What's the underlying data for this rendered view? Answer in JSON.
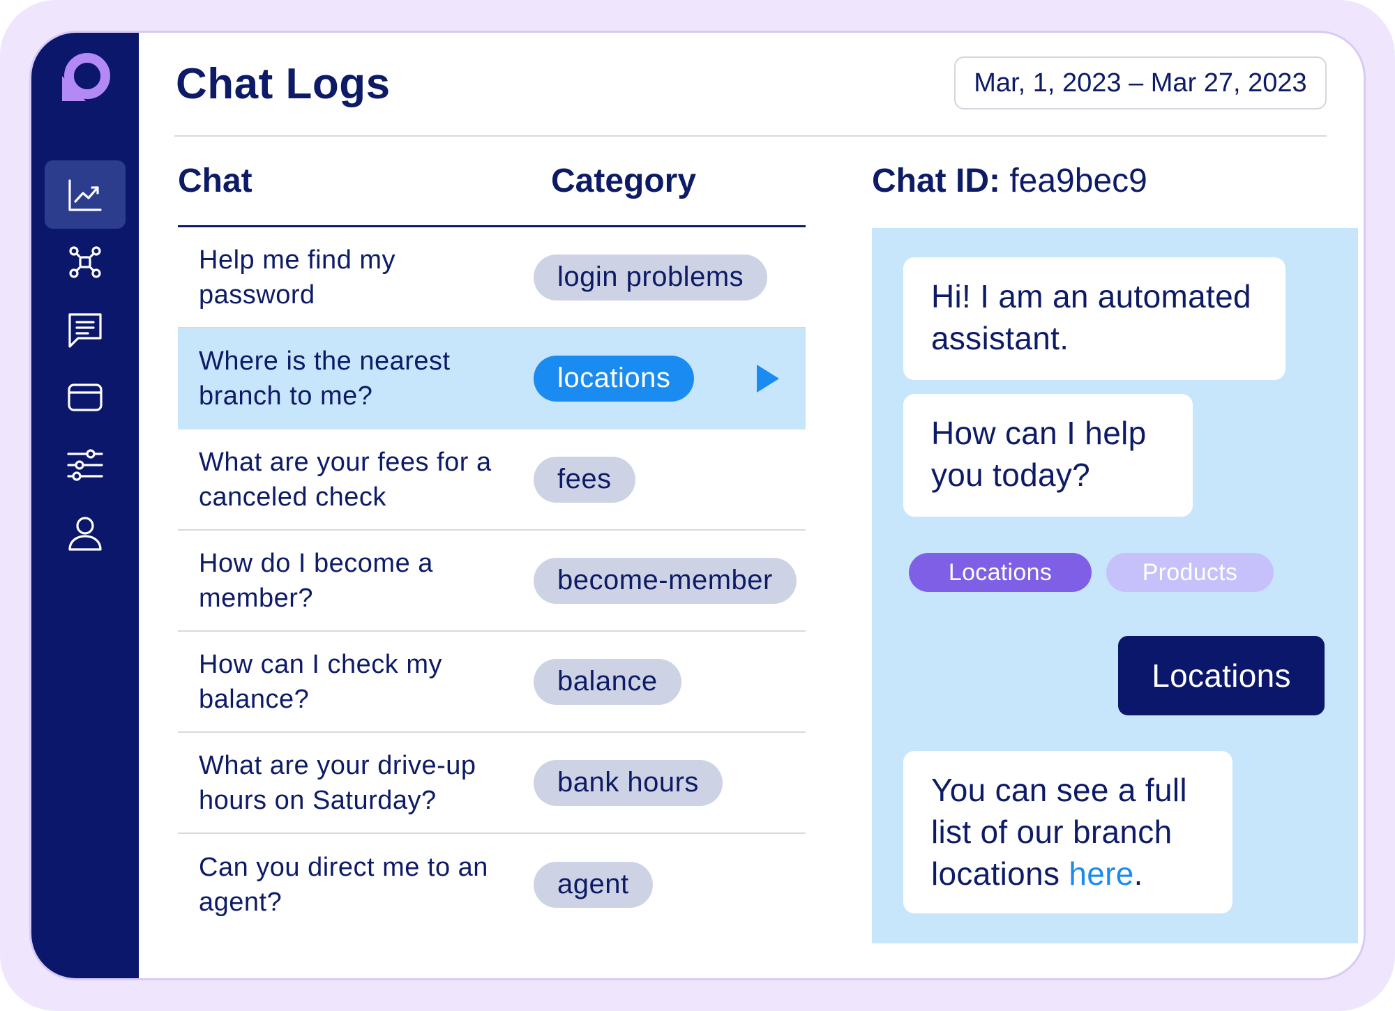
{
  "header": {
    "title": "Chat Logs",
    "date_range": "Mar, 1, 2023 – Mar 27, 2023"
  },
  "table": {
    "col_chat": "Chat",
    "col_category": "Category",
    "rows": [
      {
        "text": "Help me find my password",
        "category": "login problems"
      },
      {
        "text": "Where is the nearest branch to me?",
        "category": "locations"
      },
      {
        "text": "What are your fees for a canceled check",
        "category": "fees"
      },
      {
        "text": "How do I become a member?",
        "category": "become-member"
      },
      {
        "text": "How can I check my balance?",
        "category": "balance"
      },
      {
        "text": "What are your drive-up hours on Saturday?",
        "category": "bank hours"
      },
      {
        "text": "Can you direct me to an agent?",
        "category": "agent"
      }
    ]
  },
  "chat": {
    "id_label": "Chat ID:",
    "id_value": "fea9bec9",
    "bot_msg_1": "Hi! I am an automated assistant.",
    "bot_msg_2": "How can I help you today?",
    "quick_reply_1": "Locations",
    "quick_reply_2": "Products",
    "user_msg": "Locations",
    "bot_msg_3_prefix": "You can see a full list of our branch locations ",
    "bot_msg_3_link": "here",
    "bot_msg_3_suffix": "."
  },
  "colors": {
    "sidebar": "#0b176a",
    "accent_blue": "#1a8bf0",
    "selected_row": "#c8e6fb",
    "tag_gray": "#cdd3e4",
    "quick_purple": "#7e5fe6",
    "quick_lavender": "#c6c0fb"
  },
  "icons": {
    "logo": "chat-bubble-logo-icon",
    "nav": [
      "analytics-icon",
      "network-icon",
      "message-icon",
      "card-icon",
      "sliders-icon",
      "user-icon"
    ]
  }
}
